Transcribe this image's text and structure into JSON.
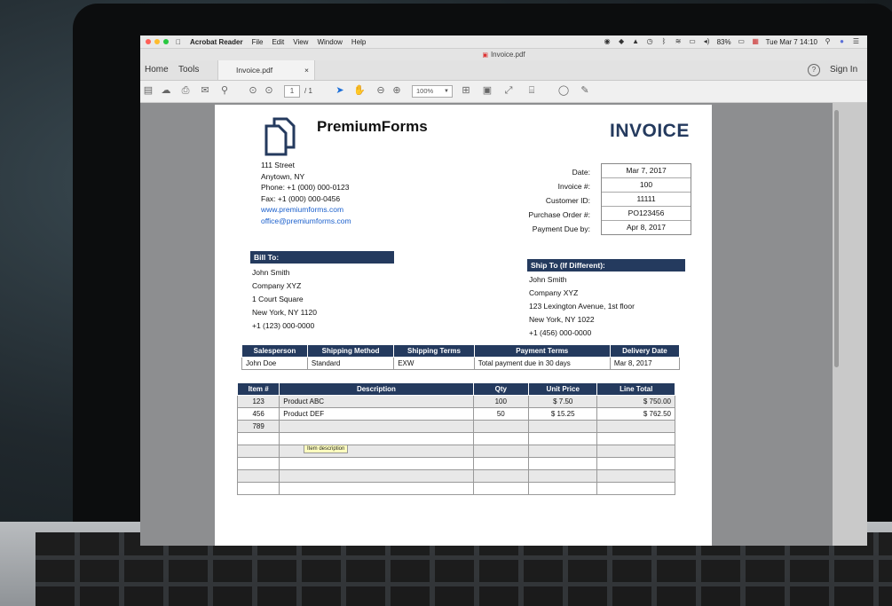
{
  "menubar": {
    "app": "Acrobat Reader",
    "items": [
      "File",
      "Edit",
      "View",
      "Window",
      "Help"
    ],
    "battery": "83%",
    "datetime": "Tue Mar 7  14:10"
  },
  "window_title": "Invoice.pdf",
  "tabs": {
    "home": "Home",
    "tools": "Tools",
    "doc": "Invoice.pdf",
    "close": "×"
  },
  "signin": "Sign In",
  "help": "?",
  "toolbar": {
    "page_current": "1",
    "page_total": "/ 1",
    "zoom": "100%"
  },
  "document": {
    "company": "PremiumForms",
    "title": "INVOICE",
    "address": {
      "street": "111 Street",
      "city": "Anytown, NY",
      "phone": "Phone:  +1 (000) 000-0123",
      "fax": "Fax:  +1 (000) 000-0456",
      "web": "www.premiumforms.com",
      "email": "office@premiumforms.com"
    },
    "meta": {
      "labels": [
        "Date:",
        "Invoice #:",
        "Customer ID:",
        "Purchase Order #:",
        "Payment Due by:"
      ],
      "values": [
        "Mar 7, 2017",
        "100",
        "11111",
        "PO123456",
        "Apr 8, 2017"
      ]
    },
    "bill_to": {
      "header": "Bill To:",
      "lines": [
        "John Smith",
        "Company XYZ",
        "1 Court Square",
        "New York, NY 1120",
        "+1 (123) 000-0000"
      ]
    },
    "ship_to": {
      "header": "Ship To (If Different):",
      "lines": [
        "John Smith",
        "Company XYZ",
        "123 Lexington Avenue, 1st floor",
        "New York, NY 1022",
        "+1 (456) 000-0000"
      ]
    },
    "sales_table": {
      "headers": [
        "Salesperson",
        "Shipping Method",
        "Shipping Terms",
        "Payment Terms",
        "Delivery Date"
      ],
      "row": [
        "John Doe",
        "Standard",
        "EXW",
        "Total payment due in 30 days",
        "Mar 8, 2017"
      ]
    },
    "items_table": {
      "headers": [
        "Item #",
        "Description",
        "Qty",
        "Unit Price",
        "Line Total"
      ],
      "rows": [
        [
          "123",
          "Product ABC",
          "100",
          "$ 7.50",
          "$ 750.00"
        ],
        [
          "456",
          "Product DEF",
          "50",
          "$ 15.25",
          "$ 762.50"
        ],
        [
          "789",
          "",
          "",
          "",
          ""
        ]
      ]
    },
    "tooltip": "Item description"
  }
}
